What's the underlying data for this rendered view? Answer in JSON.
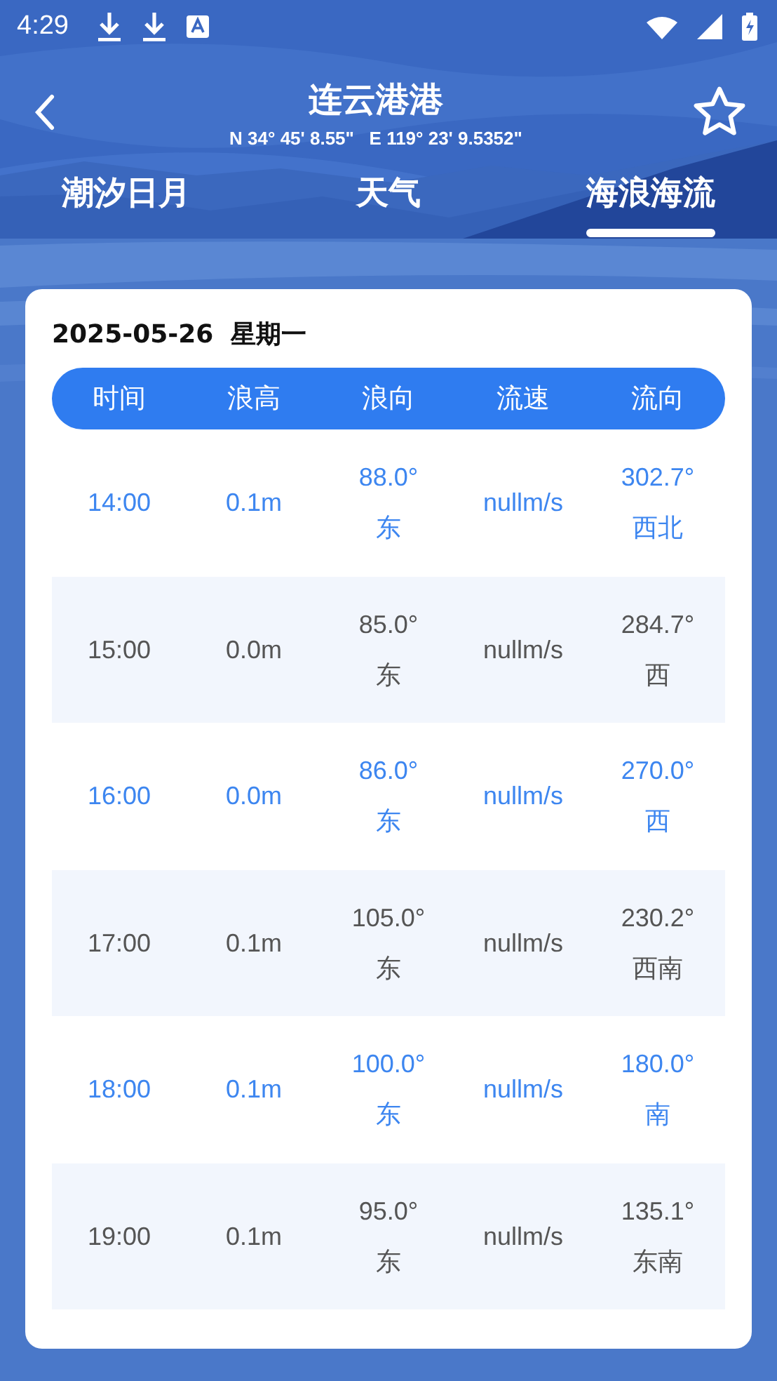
{
  "status_bar": {
    "time": "4:29"
  },
  "header": {
    "title": "连云港港",
    "coordinates": "N 34° 45' 8.55\"   E 119° 23' 9.5352\"",
    "favorite": false
  },
  "tabs": [
    {
      "label": "潮汐日月",
      "selected": false
    },
    {
      "label": "天气",
      "selected": false
    },
    {
      "label": "海浪海流",
      "selected": true
    }
  ],
  "date": "2025-05-26  星期一",
  "table": {
    "columns": [
      "时间",
      "浪高",
      "浪向",
      "流速",
      "流向"
    ],
    "rows": [
      {
        "highlighted": true,
        "cells": [
          "14:00",
          "0.1m",
          "88.0°\n东",
          "nullm/s",
          "302.7°\n西北"
        ]
      },
      {
        "highlighted": false,
        "cells": [
          "15:00",
          "0.0m",
          "85.0°\n东",
          "nullm/s",
          "284.7°\n西"
        ]
      },
      {
        "highlighted": true,
        "cells": [
          "16:00",
          "0.0m",
          "86.0°\n东",
          "nullm/s",
          "270.0°\n西"
        ]
      },
      {
        "highlighted": false,
        "cells": [
          "17:00",
          "0.1m",
          "105.0°\n东",
          "nullm/s",
          "230.2°\n西南"
        ]
      },
      {
        "highlighted": true,
        "cells": [
          "18:00",
          "0.1m",
          "100.0°\n东",
          "nullm/s",
          "180.0°\n南"
        ]
      },
      {
        "highlighted": false,
        "cells": [
          "19:00",
          "0.1m",
          "95.0°\n东",
          "nullm/s",
          "135.1°\n东南"
        ]
      }
    ]
  }
}
